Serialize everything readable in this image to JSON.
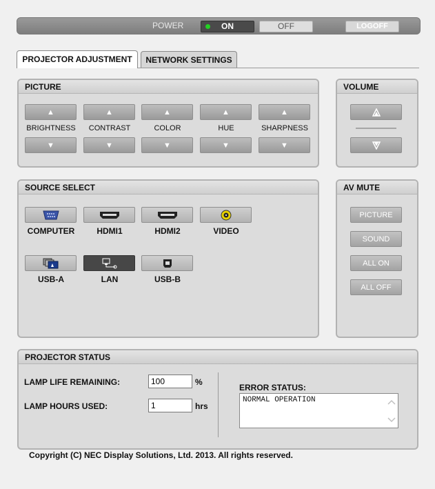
{
  "power": {
    "label": "POWER",
    "on": "ON",
    "off": "OFF",
    "logoff": "LOGOFF",
    "on_indicator_color": "#23d223"
  },
  "tabs": [
    {
      "label": "PROJECTOR ADJUSTMENT",
      "active": true
    },
    {
      "label": "NETWORK SETTINGS",
      "active": false
    }
  ],
  "picture": {
    "title": "PICTURE",
    "controls": [
      {
        "label": "BRIGHTNESS"
      },
      {
        "label": "CONTRAST"
      },
      {
        "label": "COLOR"
      },
      {
        "label": "HUE"
      },
      {
        "label": "SHARPNESS"
      }
    ],
    "up_icon": "▲",
    "down_icon": "▼"
  },
  "volume": {
    "title": "VOLUME",
    "up_icon": "up-arrow-icon",
    "down_icon": "down-arrow-icon"
  },
  "source": {
    "title": "SOURCE SELECT",
    "items": [
      {
        "label": "COMPUTER",
        "icon": "vga-connector-icon",
        "active": false
      },
      {
        "label": "HDMI1",
        "icon": "hdmi-connector-icon",
        "active": false
      },
      {
        "label": "HDMI2",
        "icon": "hdmi-connector-icon",
        "active": false
      },
      {
        "label": "VIDEO",
        "icon": "rca-connector-icon",
        "active": false
      },
      {
        "label": "USB-A",
        "icon": "usb-viewer-icon",
        "active": false
      },
      {
        "label": "LAN",
        "icon": "lan-network-icon",
        "active": true
      },
      {
        "label": "USB-B",
        "icon": "usb-b-connector-icon",
        "active": false
      }
    ]
  },
  "av_mute": {
    "title": "AV MUTE",
    "buttons": [
      {
        "label": "PICTURE"
      },
      {
        "label": "SOUND"
      },
      {
        "label": "ALL ON"
      },
      {
        "label": "ALL OFF"
      }
    ]
  },
  "status": {
    "title": "PROJECTOR STATUS",
    "lamp_life_label": "LAMP LIFE REMAINING:",
    "lamp_life_value": "100",
    "lamp_life_unit": "%",
    "lamp_hours_label": "LAMP HOURS USED:",
    "lamp_hours_value": "1",
    "lamp_hours_unit": "hrs",
    "error_label": "ERROR STATUS:",
    "error_value": "NORMAL OPERATION"
  },
  "copyright": "Copyright (C) NEC Display Solutions, Ltd. 2013. All rights reserved."
}
